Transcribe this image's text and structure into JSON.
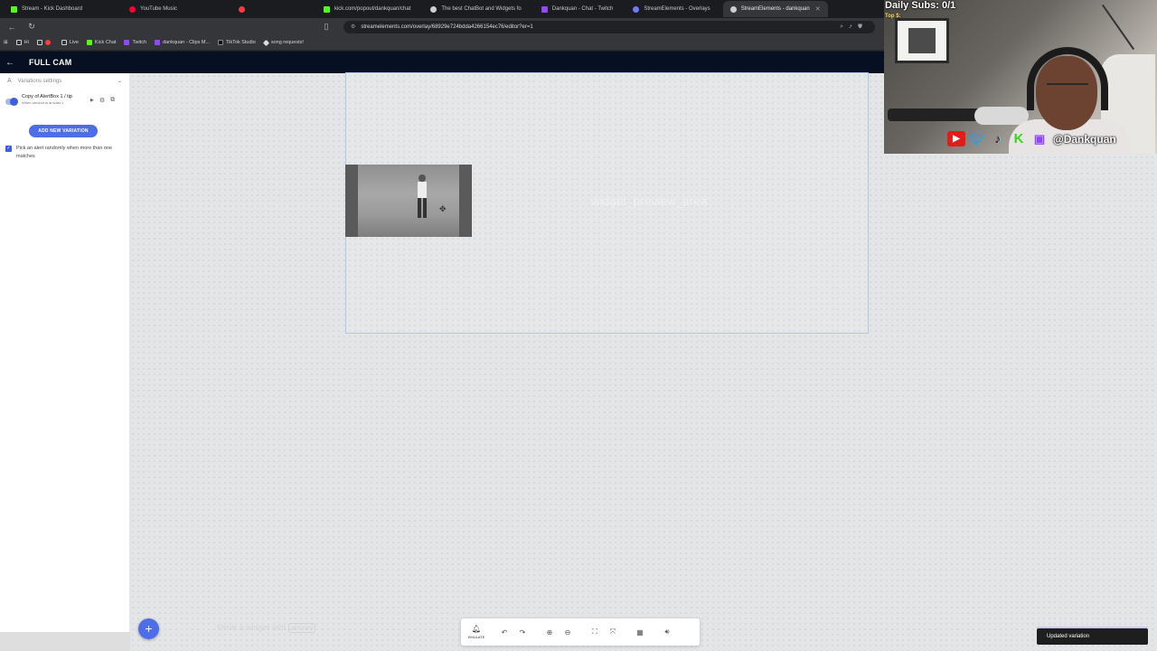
{
  "browser": {
    "tabs": [
      {
        "label": "Stream - Kick Dashboard",
        "icon": "kick-icon",
        "color": "#53fc18"
      },
      {
        "label": "YouTube Music",
        "icon": "youtube-music-icon",
        "color": "#ff0033"
      },
      {
        "label": "",
        "icon": "recording-icon",
        "color": "#ff3b3b"
      },
      {
        "label": "kick.com/popout/dankquan/chat",
        "icon": "kick-icon",
        "color": "#53fc18"
      },
      {
        "label": "The best ChatBot and Widgets fo",
        "icon": "streamelements-icon",
        "color": "#cfcfcf"
      },
      {
        "label": "Dankquan - Chat - Twitch",
        "icon": "twitch-icon",
        "color": "#9146ff"
      },
      {
        "label": "StreamElements - Overlays",
        "icon": "streamelements-icon",
        "color": "#6f7bff"
      },
      {
        "label": "StreamElements - dankquan",
        "icon": "streamelements-icon",
        "color": "#cfcfcf",
        "active": true
      }
    ],
    "url": "streamelements.com/overlay/68929e724bdda4266154ec76/editor?er=1",
    "bookmarks": [
      {
        "label": "Hi",
        "icon": "folder-icon"
      },
      {
        "label": "",
        "icon": "folder-icon"
      },
      {
        "label": "Live",
        "icon": "folder-icon"
      },
      {
        "label": "Kick Chat",
        "icon": "kick-icon"
      },
      {
        "label": "Twitch",
        "icon": "twitch-icon"
      },
      {
        "label": "dankquan - Clips M...",
        "icon": "twitch-icon"
      },
      {
        "label": "TikTok Studio",
        "icon": "tiktok-icon"
      },
      {
        "label": "song requests!",
        "icon": "streamelements-icon"
      }
    ]
  },
  "header": {
    "title": "FULL CAM"
  },
  "sidebar": {
    "section_label": "Variations settings",
    "variation": {
      "name": "Copy of AlertBox 1 / tip",
      "condition": "When amount is at least 1"
    },
    "add_button": "ADD NEW VARIATION",
    "random_pick_label": "Pick an alert randomly when more than one matches"
  },
  "canvas": {
    "ghost_text": "widget_preview_area",
    "hint_prefix": "Move a widget with",
    "hint_key": "arrows"
  },
  "bottom_toolbar": {
    "emulate_label": "EMULATE"
  },
  "toast": {
    "message": "Updated variation"
  },
  "webcam": {
    "subs_text": "Daily Subs: 0/1",
    "top_text": "Top $:",
    "handle": "@Dankquan"
  },
  "colors": {
    "accent": "#4d6ee8",
    "header_bg": "#061022"
  }
}
